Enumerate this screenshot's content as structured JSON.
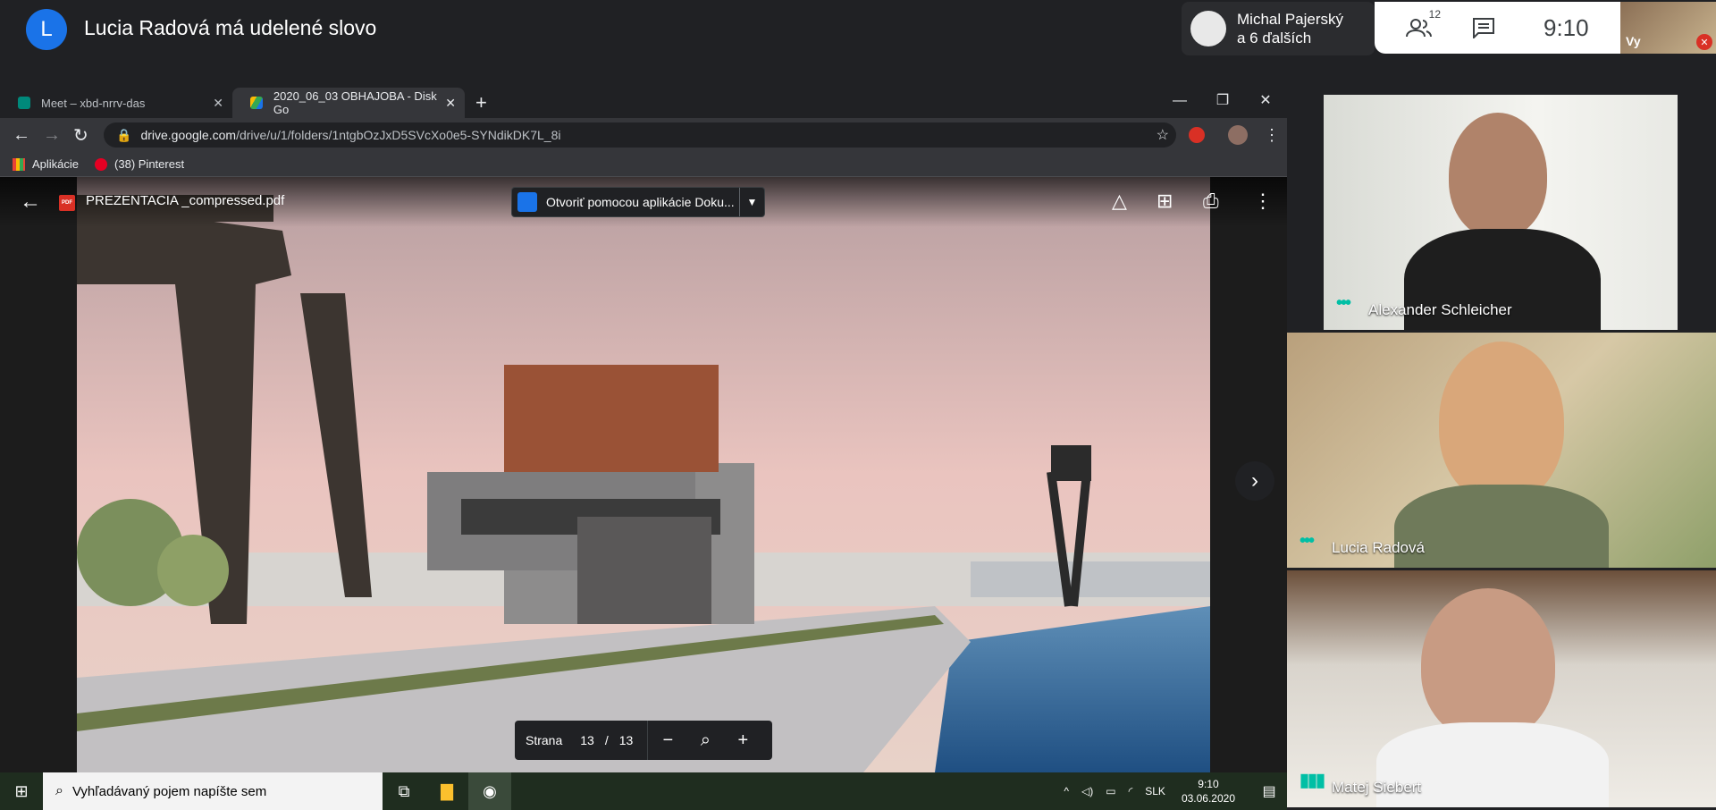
{
  "meet": {
    "presenter_initial": "L",
    "presenter_text": "Lucia Radová má udelené slovo",
    "people_chip_line1": "Michal Pajerský",
    "people_chip_line2": "a 6 ďalších",
    "participant_count": "12",
    "clock": "9:10",
    "self_label": "Vy"
  },
  "browser": {
    "tabs": [
      {
        "title": "Meet – xbd-nrrv-das"
      },
      {
        "title": "2020_06_03 OBHAJOBA - Disk Go"
      }
    ],
    "url_domain": "drive.google.com",
    "url_path": "/drive/u/1/folders/1ntgbOzJxD5SVcXo0e5-SYNdikDK7L_8i",
    "bookmarks": [
      "Aplikácie",
      "(38) Pinterest"
    ]
  },
  "viewer": {
    "pdf_badge": "PDF",
    "filename": "PREZENTACIA _compressed.pdf",
    "open_with": "Otvoriť pomocou aplikácie Doku...",
    "page_label": "Strana",
    "current_page": "13",
    "page_sep": "/",
    "total_pages": "13"
  },
  "participants": [
    {
      "name": "Alexander Schleicher"
    },
    {
      "name": "Lucia Radová"
    },
    {
      "name": "Matej Siebert"
    }
  ],
  "taskbar": {
    "search_placeholder": "Vyhľadávaný pojem napíšte sem",
    "language": "SLK",
    "time": "9:10",
    "date": "03.06.2020"
  },
  "icons": {
    "people": "people-icon",
    "chat": "chat-icon",
    "mic_off": "mic-off-icon"
  }
}
